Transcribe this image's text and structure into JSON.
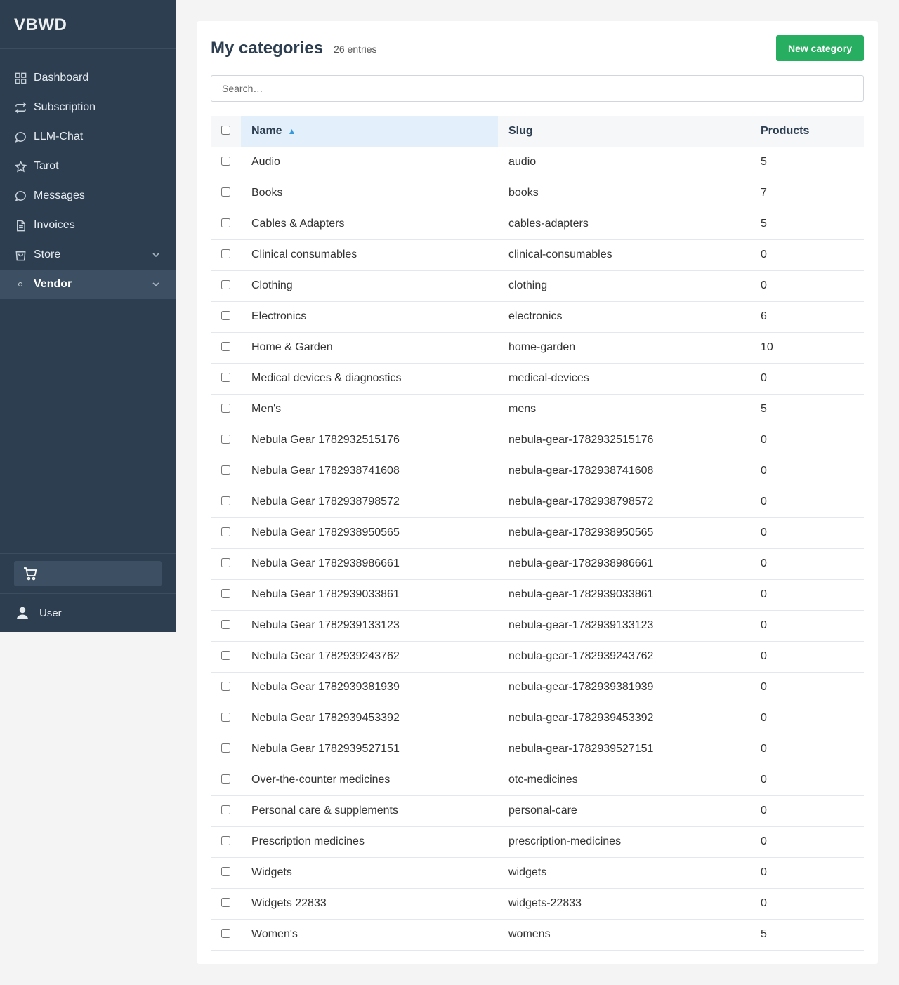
{
  "brand": "VBWD",
  "nav": [
    {
      "label": "Dashboard",
      "icon": "grid-icon"
    },
    {
      "label": "Subscription",
      "icon": "repeat-icon"
    },
    {
      "label": "LLM-Chat",
      "icon": "chat-bubble-icon"
    },
    {
      "label": "Tarot",
      "icon": "star-icon"
    },
    {
      "label": "Messages",
      "icon": "chat-bubble-icon"
    },
    {
      "label": "Invoices",
      "icon": "document-icon"
    },
    {
      "label": "Store",
      "icon": "shopping-bag-icon"
    },
    {
      "label": "Vendor",
      "icon": "dot-icon"
    }
  ],
  "user": {
    "label": "User"
  },
  "page": {
    "title": "My categories",
    "entries": "26 entries",
    "new_button": "New category",
    "search_placeholder": "Search…"
  },
  "table": {
    "headers": {
      "name": "Name",
      "slug": "Slug",
      "products": "Products"
    },
    "sort_indicator": "▲",
    "rows": [
      {
        "name": "Audio",
        "slug": "audio",
        "products": "5"
      },
      {
        "name": "Books",
        "slug": "books",
        "products": "7"
      },
      {
        "name": "Cables & Adapters",
        "slug": "cables-adapters",
        "products": "5"
      },
      {
        "name": "Clinical consumables",
        "slug": "clinical-consumables",
        "products": "0"
      },
      {
        "name": "Clothing",
        "slug": "clothing",
        "products": "0"
      },
      {
        "name": "Electronics",
        "slug": "electronics",
        "products": "6"
      },
      {
        "name": "Home & Garden",
        "slug": "home-garden",
        "products": "10"
      },
      {
        "name": "Medical devices & diagnostics",
        "slug": "medical-devices",
        "products": "0"
      },
      {
        "name": "Men's",
        "slug": "mens",
        "products": "5"
      },
      {
        "name": "Nebula Gear 1782932515176",
        "slug": "nebula-gear-1782932515176",
        "products": "0"
      },
      {
        "name": "Nebula Gear 1782938741608",
        "slug": "nebula-gear-1782938741608",
        "products": "0"
      },
      {
        "name": "Nebula Gear 1782938798572",
        "slug": "nebula-gear-1782938798572",
        "products": "0"
      },
      {
        "name": "Nebula Gear 1782938950565",
        "slug": "nebula-gear-1782938950565",
        "products": "0"
      },
      {
        "name": "Nebula Gear 1782938986661",
        "slug": "nebula-gear-1782938986661",
        "products": "0"
      },
      {
        "name": "Nebula Gear 1782939033861",
        "slug": "nebula-gear-1782939033861",
        "products": "0"
      },
      {
        "name": "Nebula Gear 1782939133123",
        "slug": "nebula-gear-1782939133123",
        "products": "0"
      },
      {
        "name": "Nebula Gear 1782939243762",
        "slug": "nebula-gear-1782939243762",
        "products": "0"
      },
      {
        "name": "Nebula Gear 1782939381939",
        "slug": "nebula-gear-1782939381939",
        "products": "0"
      },
      {
        "name": "Nebula Gear 1782939453392",
        "slug": "nebula-gear-1782939453392",
        "products": "0"
      },
      {
        "name": "Nebula Gear 1782939527151",
        "slug": "nebula-gear-1782939527151",
        "products": "0"
      },
      {
        "name": "Over-the-counter medicines",
        "slug": "otc-medicines",
        "products": "0"
      },
      {
        "name": "Personal care & supplements",
        "slug": "personal-care",
        "products": "0"
      },
      {
        "name": "Prescription medicines",
        "slug": "prescription-medicines",
        "products": "0"
      },
      {
        "name": "Widgets",
        "slug": "widgets",
        "products": "0"
      },
      {
        "name": "Widgets 22833",
        "slug": "widgets-22833",
        "products": "0"
      },
      {
        "name": "Women's",
        "slug": "womens",
        "products": "5"
      }
    ]
  },
  "colors": {
    "sidebar": "#2c3e50",
    "active_nav": "#3d5063",
    "primary_button": "#27ae60",
    "sort_highlight": "#e3f0fb",
    "sort_arrow": "#3498db"
  }
}
